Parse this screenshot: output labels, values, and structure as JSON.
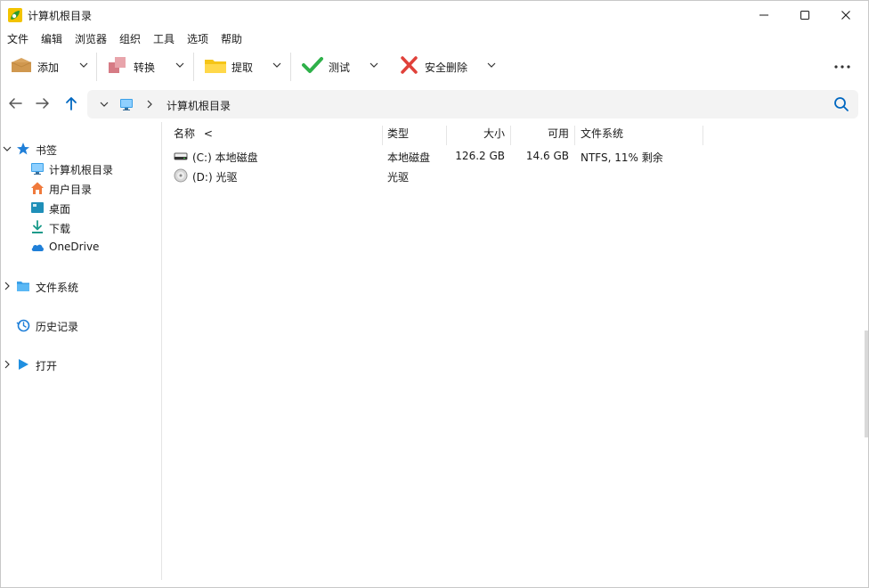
{
  "window": {
    "title": "计算机根目录",
    "controls": {
      "minimize": "minimize-icon",
      "maximize": "maximize-icon",
      "close": "close-icon"
    }
  },
  "menu": [
    "文件",
    "编辑",
    "浏览器",
    "组织",
    "工具",
    "选项",
    "帮助"
  ],
  "toolbar": {
    "add": "添加",
    "convert": "转换",
    "extract": "提取",
    "test": "测试",
    "delete": "安全删除"
  },
  "address": {
    "path": "计算机根目录"
  },
  "sidebar": {
    "bookmarks": "书签",
    "items": [
      "计算机根目录",
      "用户目录",
      "桌面",
      "下载",
      "OneDrive"
    ],
    "filesystem": "文件系统",
    "history": "历史记录",
    "open": "打开"
  },
  "columns": {
    "name": "名称",
    "sort_indicator": "<",
    "type": "类型",
    "size": "大小",
    "free": "可用",
    "fs": "文件系统"
  },
  "rows": [
    {
      "name": "(C:) 本地磁盘",
      "type": "本地磁盘",
      "size": "126.2 GB",
      "free": "14.6 GB",
      "fs": "NTFS, 11% 剩余"
    },
    {
      "name": "(D:) 光驱",
      "type": "光驱",
      "size": "",
      "free": "",
      "fs": ""
    }
  ],
  "colors": {
    "accent": "#0067c0",
    "address_bg": "#f3f3f3",
    "check_green": "#2fb14a",
    "delete_red": "#e0413a"
  }
}
